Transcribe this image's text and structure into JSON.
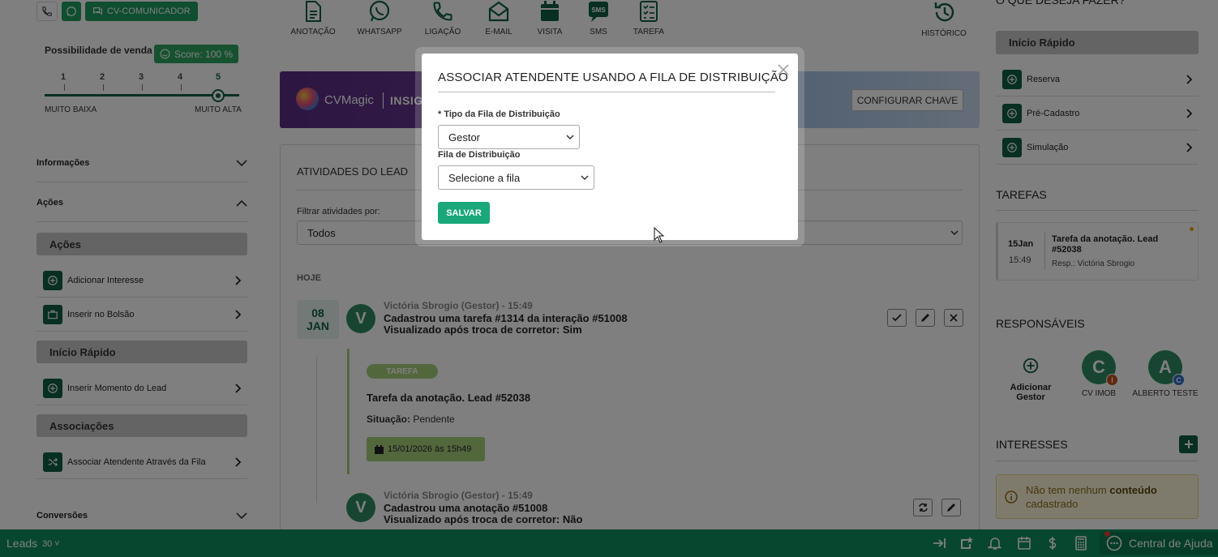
{
  "header": {
    "cv_comunicador_label": "CV-COMUNICADOR"
  },
  "score": {
    "title": "Possibilidade de venda",
    "badge": "Score: 100 %",
    "scale": [
      "1",
      "2",
      "3",
      "4",
      "5"
    ],
    "selected": "5",
    "low_label": "MUITO BAIXA",
    "high_label": "MUITO ALTA"
  },
  "toolbar": {
    "items": [
      {
        "label": "ANOTAÇÃO",
        "icon": "note-icon"
      },
      {
        "label": "WHATSAPP",
        "icon": "whatsapp-icon"
      },
      {
        "label": "LIGAÇÃO",
        "icon": "phone-icon"
      },
      {
        "label": "E-MAIL",
        "icon": "email-icon"
      },
      {
        "label": "VISITA",
        "icon": "calendar-icon"
      },
      {
        "label": "SMS",
        "icon": "sms-icon"
      },
      {
        "label": "TAREFA",
        "icon": "checklist-icon"
      }
    ],
    "history_label": "HISTÓRICO"
  },
  "banner": {
    "brand": "CVMagic",
    "partial": "INSIG",
    "config_label": "CONFIGURAR CHAVE"
  },
  "sidebar": {
    "informacoes": "Informações",
    "acoes": "Ações",
    "acoes_head": "Ações",
    "acoes_items": [
      "Adicionar Interesse",
      "Inserir no Bolsão"
    ],
    "inicio_head": "Início Rápido",
    "inicio_items": [
      "Inserir Momento do Lead"
    ],
    "assoc_head": "Associações",
    "assoc_items": [
      "Associar Atendente Através da Fila"
    ],
    "conversoes": "Conversões"
  },
  "activities": {
    "title": "ATIVIDADES DO LEAD",
    "filter_label": "Filtrar atividades por:",
    "filter_value": "Todos",
    "today": "HOJE",
    "date_day": "08",
    "date_month": "JAN",
    "entries": [
      {
        "avatar": "V",
        "author": "Victória Sbrogio (Gestor) - 15:49",
        "line1": "Cadastrou uma tarefa #1314 da interação #51008",
        "line2": "Visualizado após troca de corretor:  Sim"
      },
      {
        "avatar": "V",
        "author": "Victória Sbrogio (Gestor) - 15:49",
        "line1": "Cadastrou uma anotação #51008",
        "line2": "Visualizado após troca de corretor:  Não"
      }
    ],
    "task": {
      "tag": "TAREFA",
      "title": "Tarefa da anotação. Lead #52038",
      "status_label": "Situação:",
      "status_value": " Pendente",
      "due": "15/01/2026 às 15h49"
    }
  },
  "right": {
    "top_heading": "O QUE DESEJA FAZER?",
    "quick_head": "Início Rápido",
    "quick_items": [
      "Reserva",
      "Pré-Cadastro",
      "Simulação"
    ],
    "tarefas_title": "TAREFAS",
    "tarefa": {
      "day": "15Jan",
      "time": "15:49",
      "title": "Tarefa da anotação. Lead #52038",
      "resp": "Resp.: Victória Sbrogio"
    },
    "responsaveis_title": "RESPONSÁVEIS",
    "add_gestor": "Adicionar Gestor",
    "responsaveis": [
      {
        "initial": "C",
        "name": "CV IMOB",
        "badge": "I",
        "badge_color": "#c0501c"
      },
      {
        "initial": "A",
        "name": "ALBERTO TESTE",
        "badge": "C",
        "badge_color": "#2f6fc7"
      }
    ],
    "interesses_title": "INTERESSES",
    "warn_prefix": "Não tem nenhum ",
    "warn_bold": "conteúdo",
    "warn_suffix": " cadastrado"
  },
  "bottom": {
    "leads_label": "Leads",
    "leads_count": "30",
    "help_label": "Central de Ajuda"
  },
  "modal": {
    "title": "ASSOCIAR ATENDENTE USANDO A FILA DE DISTRIBUIÇÃO",
    "tipo_label": "* Tipo da Fila de Distribuição",
    "tipo_value": "Gestor",
    "fila_label": "Fila de Distribuição",
    "fila_placeholder": "Selecione a fila",
    "save_label": "SALVAR"
  },
  "colors": {
    "primary": "#0f5f45",
    "accent": "#1aa77a",
    "bottom_bar": "#0f8f5f"
  }
}
